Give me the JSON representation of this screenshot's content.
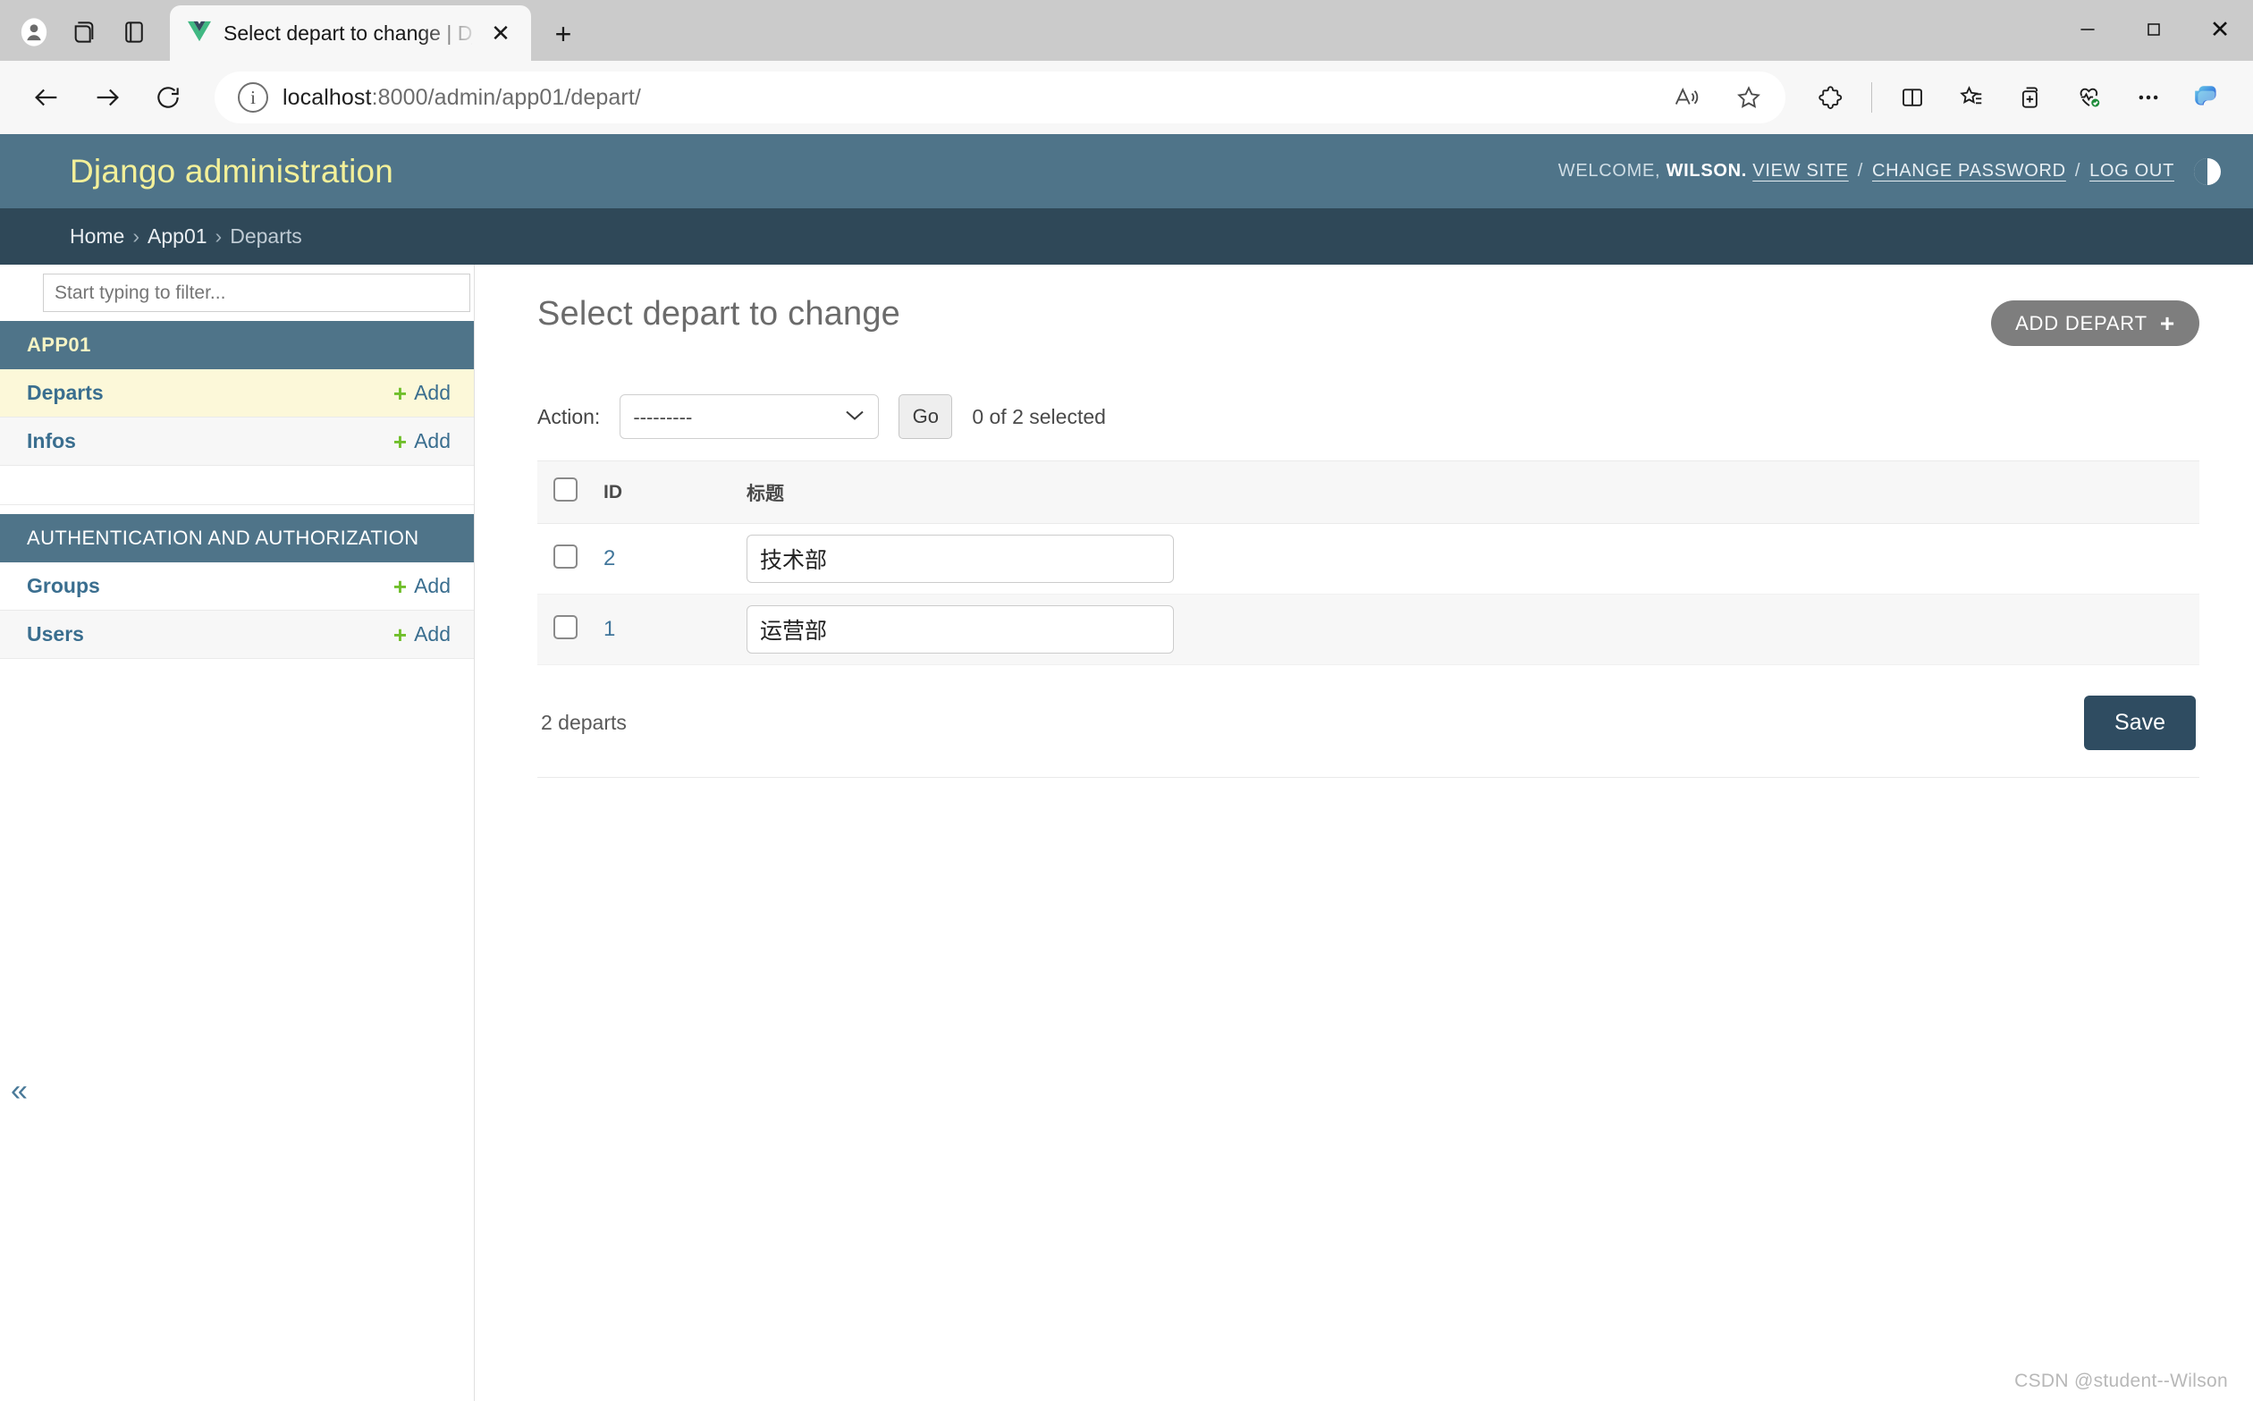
{
  "browser": {
    "tab": {
      "favicon": "vue-logo-icon",
      "title": "Select depart to change | Django",
      "close_label": "✕"
    },
    "new_tab_label": "+",
    "toolbar_left_icons": [
      "profile-icon",
      "workspaces-icon",
      "tab-actions-icon"
    ],
    "nav": {
      "back": "←",
      "forward": "→",
      "reload": "↻"
    },
    "omnibox": {
      "info_icon": "i",
      "url_host": "localhost",
      "url_path": ":8000/admin/app01/depart/",
      "read_aloud_icon": "read-aloud-icon",
      "favorite_icon": "star-icon"
    },
    "toolbar_right_icons": [
      "extensions-icon",
      "split-screen-icon",
      "collections-icon",
      "add-to-favorites-icon",
      "browser-essentials-icon",
      "settings-more-icon",
      "copilot-icon"
    ],
    "window_controls": {
      "minimize": "—",
      "maximize": "□",
      "close": "✕"
    }
  },
  "django": {
    "branding": "Django administration",
    "user_tools": {
      "welcome": "WELCOME,",
      "username": "WILSON.",
      "view_site": "VIEW SITE",
      "separator": "/",
      "change_password": "CHANGE PASSWORD",
      "log_out": "LOG OUT",
      "theme_toggle": "theme-toggle-icon"
    },
    "breadcrumbs": {
      "home": "Home",
      "sep": "›",
      "app": "App01",
      "current": "Departs"
    },
    "colors": {
      "header_bg": "#4f7489",
      "breadcrumb_bg": "#2f4858",
      "accent_yellow": "#f3f099",
      "link_blue": "#3a6e8f",
      "add_green": "#70bf2b",
      "save_bg": "#2f4c61",
      "add_button_bg": "#7e7e7e",
      "selected_row_bg": "#fcf8d9"
    }
  },
  "sidebar": {
    "filter_placeholder": "Start typing to filter...",
    "filter_value": "",
    "toggle_label": "«",
    "apps": [
      {
        "caption": "APP01",
        "caption_bold": true,
        "models": [
          {
            "name": "Departs",
            "add_label": "Add",
            "current": true
          },
          {
            "name": "Infos",
            "add_label": "Add",
            "current": false
          }
        ]
      },
      {
        "caption": "AUTHENTICATION AND AUTHORIZATION",
        "caption_bold": false,
        "models": [
          {
            "name": "Groups",
            "add_label": "Add",
            "current": false
          },
          {
            "name": "Users",
            "add_label": "Add",
            "current": false
          }
        ]
      }
    ]
  },
  "main": {
    "title": "Select depart to change",
    "add_button": {
      "label": "ADD DEPART",
      "icon": "plus-icon"
    },
    "actions": {
      "label": "Action:",
      "selected": "---------",
      "options": [
        "---------"
      ],
      "go_label": "Go",
      "counter": "0 of 2 selected"
    },
    "table": {
      "headers": [
        "",
        "ID",
        "标题"
      ],
      "rows": [
        {
          "checked": false,
          "id": "2",
          "title": "技术部"
        },
        {
          "checked": false,
          "id": "1",
          "title": "运营部"
        }
      ]
    },
    "footer": {
      "result_count": "2 departs",
      "save_label": "Save"
    }
  },
  "watermark": "CSDN @student--Wilson"
}
